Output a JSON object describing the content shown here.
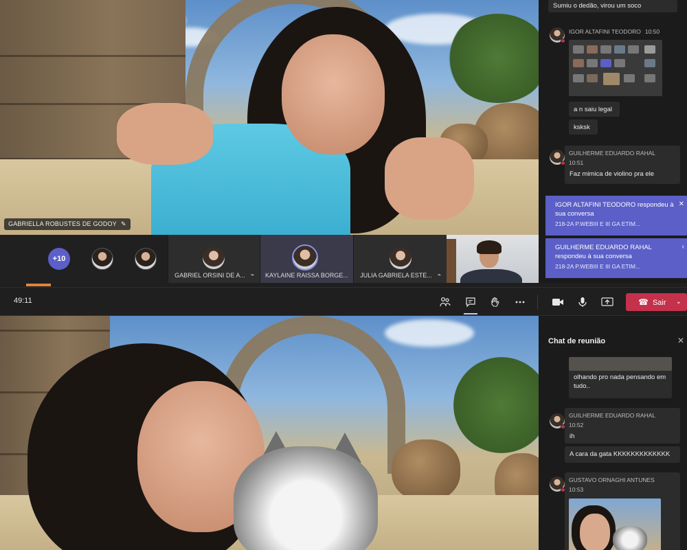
{
  "meeting": {
    "timer": "49:11",
    "leave_label": "Sair",
    "more_participants": "+10",
    "top_speaker_name": "GABRIELLA ROBUSTES DE GODOY",
    "tiles": [
      {
        "label": "GABRIEL ORSINI DE A..."
      },
      {
        "label": "KAYLAINE RAISSA BORGE..."
      },
      {
        "label": "JULIA GABRIELA ESTE..."
      }
    ]
  },
  "chat_top": {
    "messages": [
      {
        "text": "Sumiu o dedão, virou um soco"
      },
      {
        "sender": "IGOR ALTAFINI TEODORO",
        "time": "10:50"
      },
      {
        "text": "a n saiu legal"
      },
      {
        "text": "ksksk"
      },
      {
        "sender": "GUILHERME EDUARDO RAHAL",
        "time": "10:51",
        "text": "Faz mimica de violino pra ele"
      }
    ],
    "notifications": [
      {
        "title": "IGOR ALTAFINI TEODORO respondeu à sua conversa",
        "sub": "218-2A P.WEBIII E III GA ETIM..."
      },
      {
        "title": "GUILHERME EDUARDO RAHAL respondeu à sua conversa",
        "sub": "218-2A P.WEBIII E III GA ETIM..."
      }
    ]
  },
  "chat_bottom": {
    "title": "Chat de reunião",
    "messages": [
      {
        "text": "olhando pro nada pensando em tudo.."
      },
      {
        "sender": "GUILHERME EDUARDO RAHAL",
        "time": "10:52",
        "text": "ih"
      },
      {
        "text": "A cara da gata KKKKKKKKKKKKK"
      },
      {
        "sender": "GUSTAVO ORNAGHI ANTUNES",
        "time": "10:53"
      }
    ]
  },
  "colors": {
    "accent": "#5b5fc7",
    "leave": "#c4314b",
    "panel": "#1b1b1b",
    "message_bg": "#2c2c2c"
  },
  "icons": [
    "participants-icon",
    "chat-icon",
    "raise-hand-icon",
    "more-icon",
    "camera-icon",
    "mic-icon",
    "share-icon",
    "phone-icon",
    "close-icon",
    "pin-icon",
    "mic-small-icon"
  ]
}
